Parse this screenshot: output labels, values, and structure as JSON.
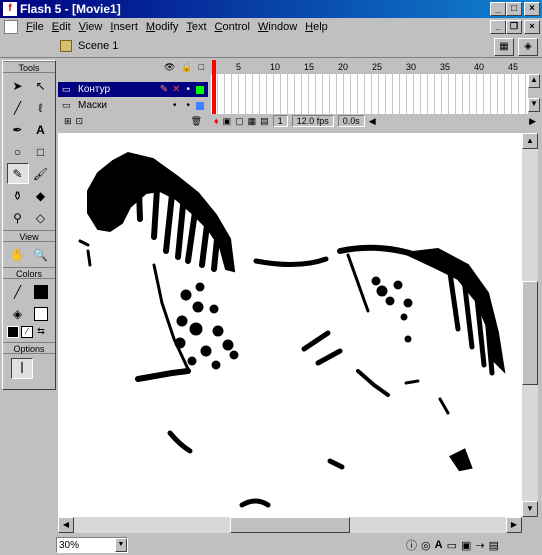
{
  "window": {
    "title": "Flash 5 - [Movie1]"
  },
  "menu": [
    "File",
    "Edit",
    "View",
    "Insert",
    "Modify",
    "Text",
    "Control",
    "Window",
    "Help"
  ],
  "scene": {
    "label": "Scene 1"
  },
  "tools": {
    "header": "Tools",
    "view_header": "View",
    "colors_header": "Colors",
    "options_header": "Options",
    "items": [
      "arrow-icon",
      "subselect-icon",
      "line-icon",
      "lasso-icon",
      "pen-icon",
      "text-icon",
      "oval-icon",
      "rectangle-icon",
      "pencil-icon",
      "brush-icon",
      "ink-bottle-icon",
      "paint-bucket-icon",
      "dropper-icon",
      "eraser-icon"
    ],
    "view_items": [
      "hand-icon",
      "magnifier-icon"
    ]
  },
  "timeline": {
    "frame_numbers": [
      "5",
      "10",
      "15",
      "20",
      "25",
      "30",
      "35",
      "40",
      "45"
    ],
    "layers": [
      {
        "name": "Контур"
      },
      {
        "name": "Маски"
      }
    ],
    "current_frame": "1",
    "fps": "12.0 fps",
    "elapsed": "0.0s"
  },
  "status": {
    "zoom": "30%"
  },
  "colors": {
    "title_start": "#000080",
    "title_end": "#1084d0",
    "layer_highlight": "#000080",
    "playhead": "#ff0000"
  }
}
